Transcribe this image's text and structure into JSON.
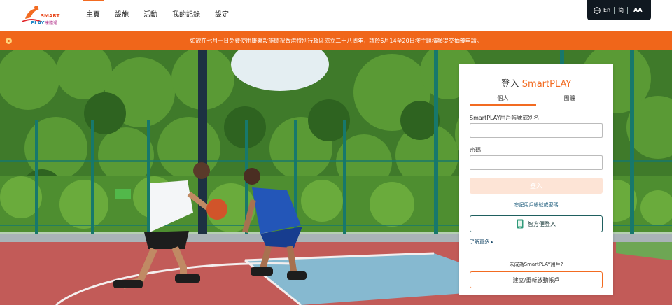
{
  "header": {
    "logo": {
      "line1": "SMART",
      "line2": "PLAY",
      "chinese": "康體通"
    },
    "nav": [
      {
        "label": "主頁",
        "active": true
      },
      {
        "label": "設施",
        "active": false
      },
      {
        "label": "活動",
        "active": false
      },
      {
        "label": "我的記錄",
        "active": false
      },
      {
        "label": "設定",
        "active": false
      }
    ],
    "util": {
      "lang_en": "En",
      "lang_sc": "简",
      "font_size": "AA"
    }
  },
  "banner": {
    "text": "如欲在七月一日免費使用康樂設施慶祝香港特別行政區成立二十八周年，請於6月14至20日按主題橫額提交抽籤申請。"
  },
  "login": {
    "title_prefix": "登入 ",
    "title_brand": "SmartPLAY",
    "tabs": [
      "個人",
      "團體"
    ],
    "account_label": "SmartPLAY用戶帳號或別名",
    "account_value": "",
    "password_label": "密碼",
    "password_value": "",
    "login_button": "登入",
    "forgot_link": "忘記用戶帳號或密碼",
    "ismart_button": "智方便登入",
    "more_link": "了解更多 ▸",
    "not_user_text": "未成為SmartPLAY用戶?",
    "create_button": "建立/重新啟動帳戶"
  },
  "colors": {
    "accent": "#f26b21",
    "banner": "#f0661a",
    "util_bar": "#101820"
  }
}
